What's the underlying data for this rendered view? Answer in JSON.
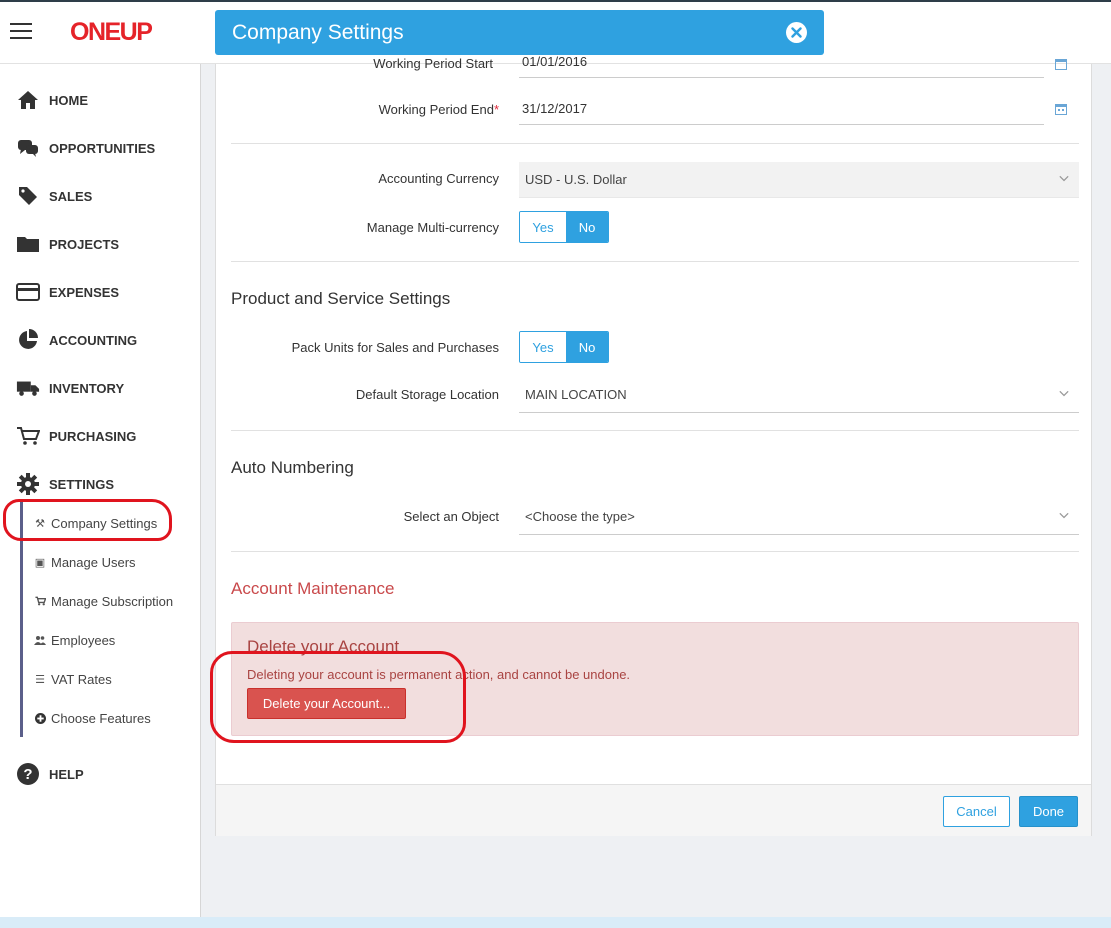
{
  "app": {
    "logo": "ONEUP"
  },
  "sidebar": {
    "items": [
      {
        "label": "HOME",
        "icon": "home-icon"
      },
      {
        "label": "OPPORTUNITIES",
        "icon": "chat-bubbles-icon"
      },
      {
        "label": "SALES",
        "icon": "tag-icon"
      },
      {
        "label": "PROJECTS",
        "icon": "folder-icon"
      },
      {
        "label": "EXPENSES",
        "icon": "credit-card-icon"
      },
      {
        "label": "ACCOUNTING",
        "icon": "pie-chart-icon"
      },
      {
        "label": "INVENTORY",
        "icon": "truck-icon"
      },
      {
        "label": "PURCHASING",
        "icon": "cart-icon"
      },
      {
        "label": "SETTINGS",
        "icon": "gear-icon"
      },
      {
        "label": "HELP",
        "icon": "question-circle-icon"
      }
    ],
    "settings_sub": [
      {
        "label": "Company Settings",
        "icon": "tools-icon"
      },
      {
        "label": "Manage Users",
        "icon": "id-card-icon"
      },
      {
        "label": "Manage Subscription",
        "icon": "cart-small-icon"
      },
      {
        "label": "Employees",
        "icon": "users-icon"
      },
      {
        "label": "VAT Rates",
        "icon": "list-icon"
      },
      {
        "label": "Choose Features",
        "icon": "plus-circle-icon"
      }
    ]
  },
  "modal": {
    "title": "Company Settings",
    "fields": {
      "period_start": {
        "label": "Working Period Start",
        "value": "01/01/2016"
      },
      "period_end": {
        "label": "Working Period End",
        "required": "*",
        "value": "31/12/2017"
      },
      "currency": {
        "label": "Accounting Currency",
        "value": "USD - U.S. Dollar"
      },
      "multi_currency": {
        "label": "Manage Multi-currency",
        "yes": "Yes",
        "no": "No"
      }
    },
    "product_section": {
      "title": "Product and Service Settings",
      "pack_units": {
        "label": "Pack Units for Sales and Purchases",
        "yes": "Yes",
        "no": "No"
      },
      "storage": {
        "label": "Default Storage Location",
        "value": "MAIN LOCATION"
      }
    },
    "numbering_section": {
      "title": "Auto Numbering",
      "object": {
        "label": "Select an Object",
        "placeholder": "<Choose the type>"
      }
    },
    "maintenance": {
      "title": "Account Maintenance",
      "alert_title": "Delete your Account",
      "alert_text": "Deleting your account is permanent action, and cannot be undone.",
      "delete_button": "Delete your Account..."
    },
    "footer": {
      "cancel": "Cancel",
      "done": "Done"
    }
  },
  "colors": {
    "accent": "#2fa1e0",
    "danger": "#d9534f",
    "brand": "#e52329",
    "annotation": "#e0141e"
  }
}
